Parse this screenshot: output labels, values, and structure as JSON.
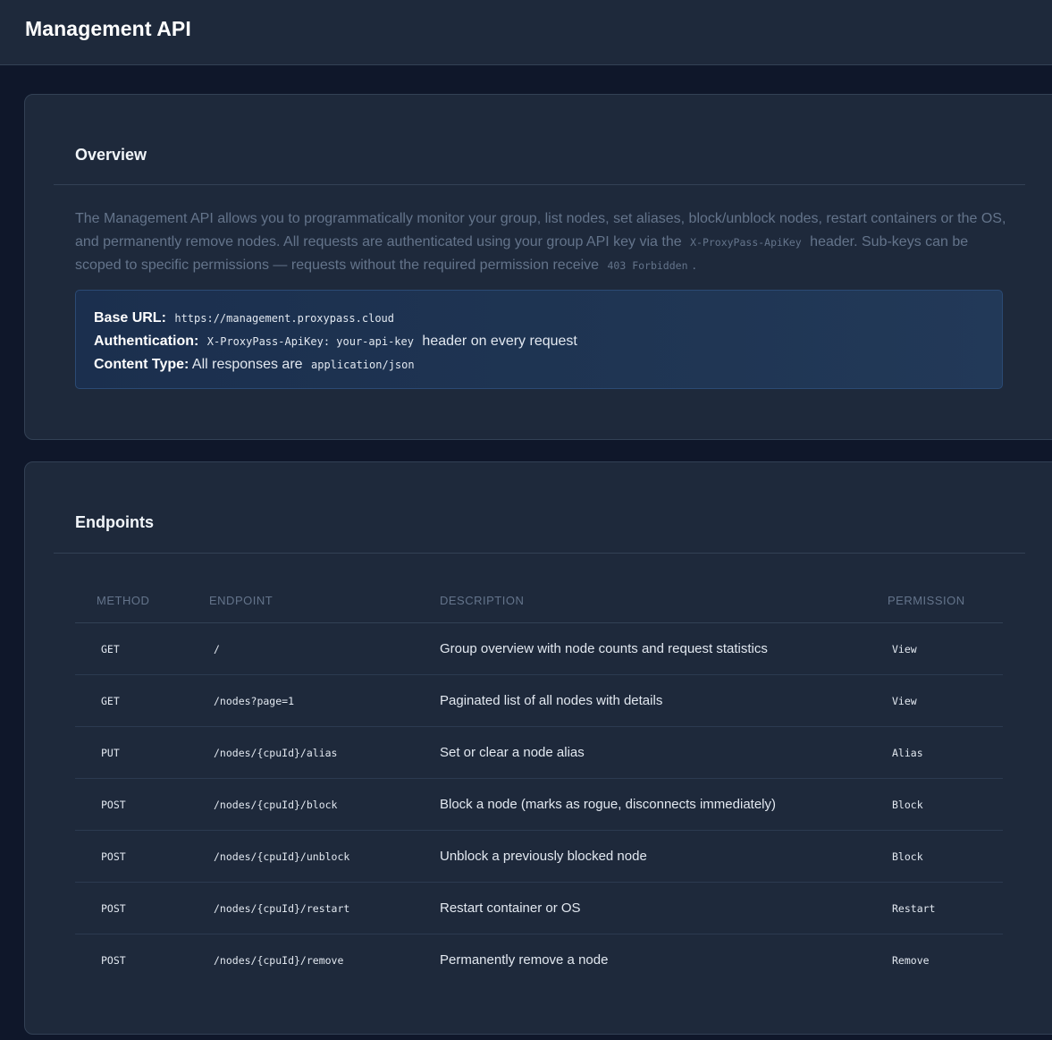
{
  "header": {
    "title": "Management API"
  },
  "overview": {
    "title": "Overview",
    "text_1": "The Management API allows you to programmatically monitor your group, list nodes, set aliases, block/unblock nodes, restart containers or the OS, and permanently remove nodes. All requests are authenticated using your group API key via the",
    "header_code": "X-ProxyPass-ApiKey",
    "text_2": "header. Sub-keys can be scoped to specific permissions — requests without the required permission receive",
    "forbidden_code": "403 Forbidden",
    "text_3": ".",
    "info": {
      "base_url_label": "Base URL:",
      "base_url_value": "https://management.proxypass.cloud",
      "auth_label": "Authentication:",
      "auth_value": "X-ProxyPass-ApiKey: your-api-key",
      "auth_suffix": "header on every request",
      "content_type_label": "Content Type:",
      "content_type_text": "All responses are",
      "content_type_value": "application/json"
    }
  },
  "endpoints": {
    "title": "Endpoints",
    "columns": {
      "method": "METHOD",
      "endpoint": "ENDPOINT",
      "description": "DESCRIPTION",
      "permission": "PERMISSION"
    },
    "rows": [
      {
        "method": "GET",
        "endpoint": "/",
        "description": "Group overview with node counts and request statistics",
        "permission": "View"
      },
      {
        "method": "GET",
        "endpoint": "/nodes?page=1",
        "description": "Paginated list of all nodes with details",
        "permission": "View"
      },
      {
        "method": "PUT",
        "endpoint": "/nodes/{cpuId}/alias",
        "description": "Set or clear a node alias",
        "permission": "Alias"
      },
      {
        "method": "POST",
        "endpoint": "/nodes/{cpuId}/block",
        "description": "Block a node (marks as rogue, disconnects immediately)",
        "permission": "Block"
      },
      {
        "method": "POST",
        "endpoint": "/nodes/{cpuId}/unblock",
        "description": "Unblock a previously blocked node",
        "permission": "Block"
      },
      {
        "method": "POST",
        "endpoint": "/nodes/{cpuId}/restart",
        "description": "Restart container or OS",
        "permission": "Restart"
      },
      {
        "method": "POST",
        "endpoint": "/nodes/{cpuId}/remove",
        "description": "Permanently remove a node",
        "permission": "Remove"
      }
    ]
  }
}
